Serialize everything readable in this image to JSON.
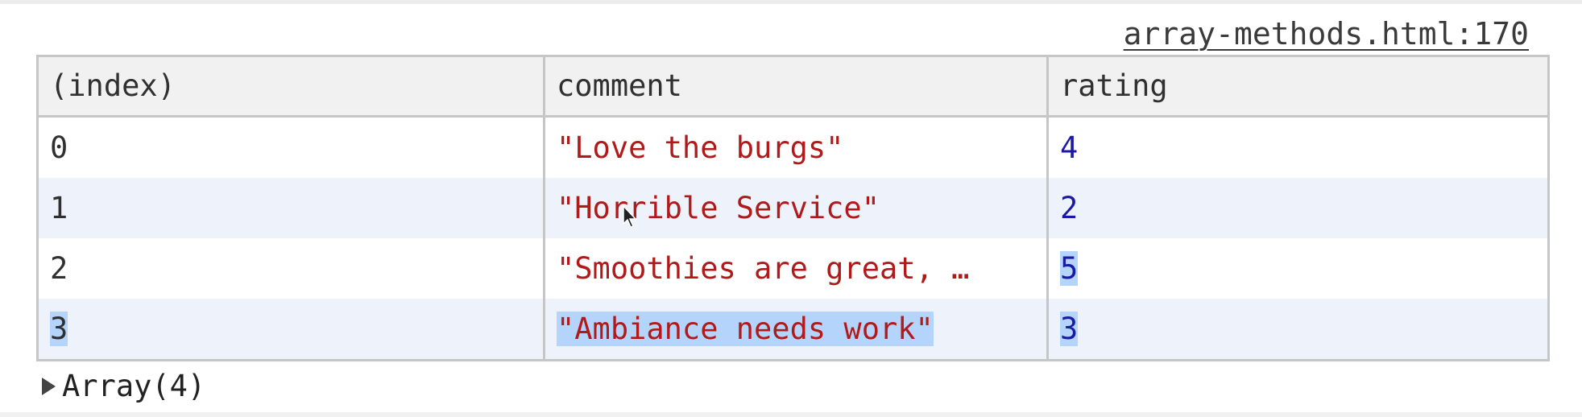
{
  "console": {
    "source_link": "array-methods.html:170",
    "table": {
      "columns": [
        "(index)",
        "comment",
        "rating"
      ],
      "rows": [
        {
          "index": "0",
          "comment": "\"Love the burgs\"",
          "rating": "4"
        },
        {
          "index": "1",
          "comment": "\"Horrible Service\"",
          "rating": "2"
        },
        {
          "index": "2",
          "comment": "\"Smoothies are great, …",
          "rating": "5"
        },
        {
          "index": "3",
          "comment": "\"Ambiance needs work\"",
          "rating": "3"
        }
      ]
    },
    "array_summary": "Array(4)",
    "collapse_icon": "triangle-right-icon",
    "cursor_icon": "mouse-pointer-icon"
  },
  "colors": {
    "string": "#b01a1a",
    "number": "#1a1aa6",
    "selection": "#b4d4fb",
    "header_bg": "#f1f1f1",
    "stripe_bg": "#eef3fb"
  }
}
